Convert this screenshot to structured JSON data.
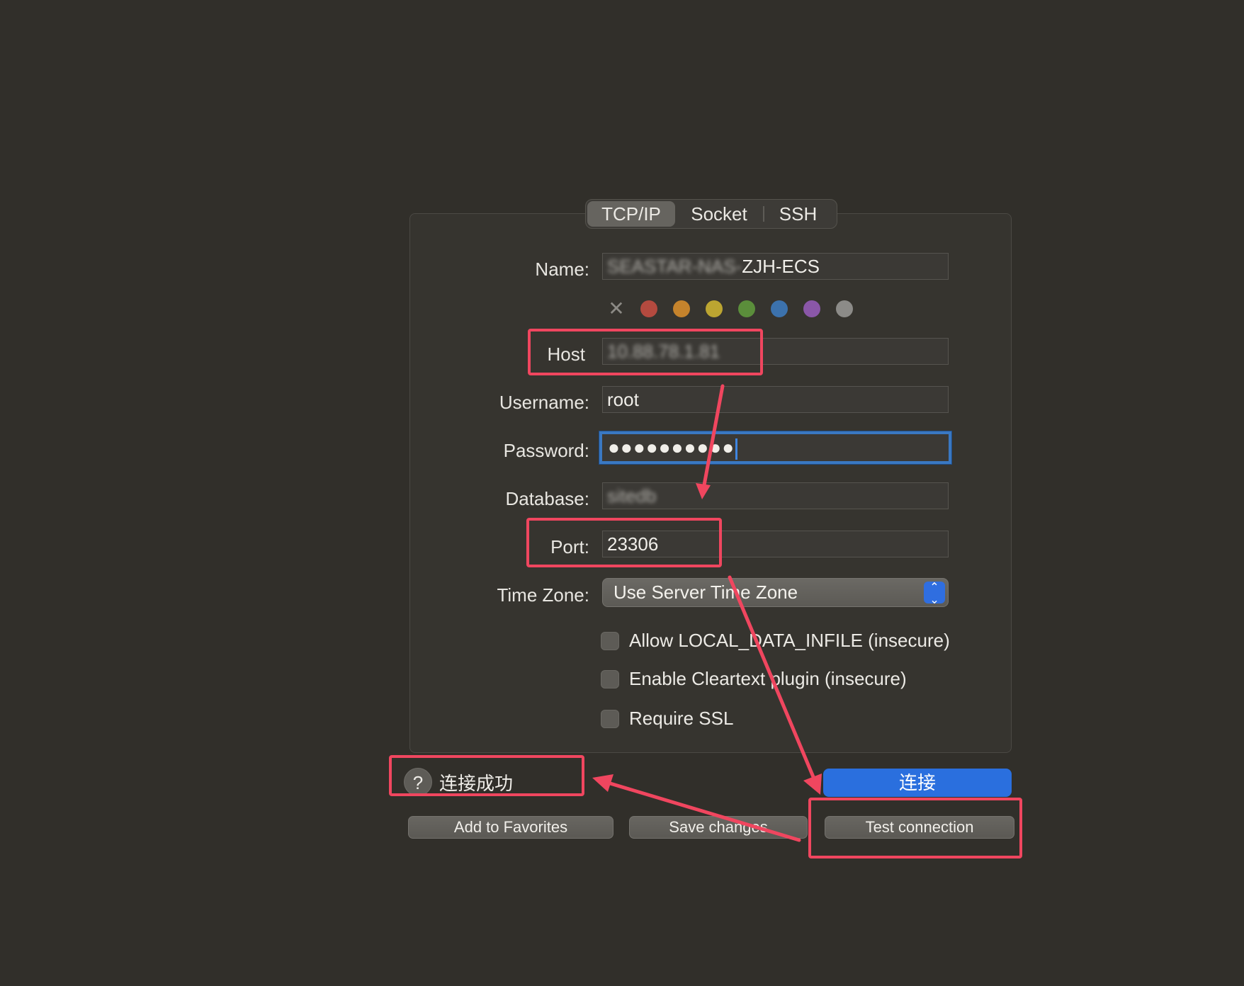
{
  "tabs": [
    {
      "label": "TCP/IP",
      "active": true
    },
    {
      "label": "Socket",
      "active": false
    },
    {
      "label": "SSH",
      "active": false
    }
  ],
  "form": {
    "name": {
      "label": "Name:",
      "value_blurred": "SEASTAR-NAS-",
      "value_visible": "ZJH-ECS"
    },
    "host": {
      "label": "Host",
      "value_blurred": "10.88.78.1.81"
    },
    "username": {
      "label": "Username:",
      "value": "root"
    },
    "password": {
      "label": "Password:",
      "value": "●●●●●●●●●●"
    },
    "database": {
      "label": "Database:",
      "value_blurred": "sitedb"
    },
    "port": {
      "label": "Port:",
      "value": "23306"
    },
    "timezone": {
      "label": "Time Zone:",
      "value": "Use Server Time Zone"
    }
  },
  "color_tags": [
    "#8c8a85",
    "#c0463c",
    "#cf8426",
    "#c9ad2b",
    "#5f9a39",
    "#3d7cc4",
    "#9159b5",
    "#8e8d8a"
  ],
  "options": [
    {
      "label": "Allow LOCAL_DATA_INFILE (insecure)",
      "checked": false
    },
    {
      "label": "Enable Cleartext plugin (insecure)",
      "checked": false
    },
    {
      "label": "Require SSL",
      "checked": false
    }
  ],
  "status": {
    "help_icon": "?",
    "text": "连接成功"
  },
  "buttons": {
    "connect": "连接",
    "add_favorites": "Add to Favorites",
    "save_changes": "Save changes",
    "test_connection": "Test connection"
  },
  "annotation_color": "#f0465f"
}
